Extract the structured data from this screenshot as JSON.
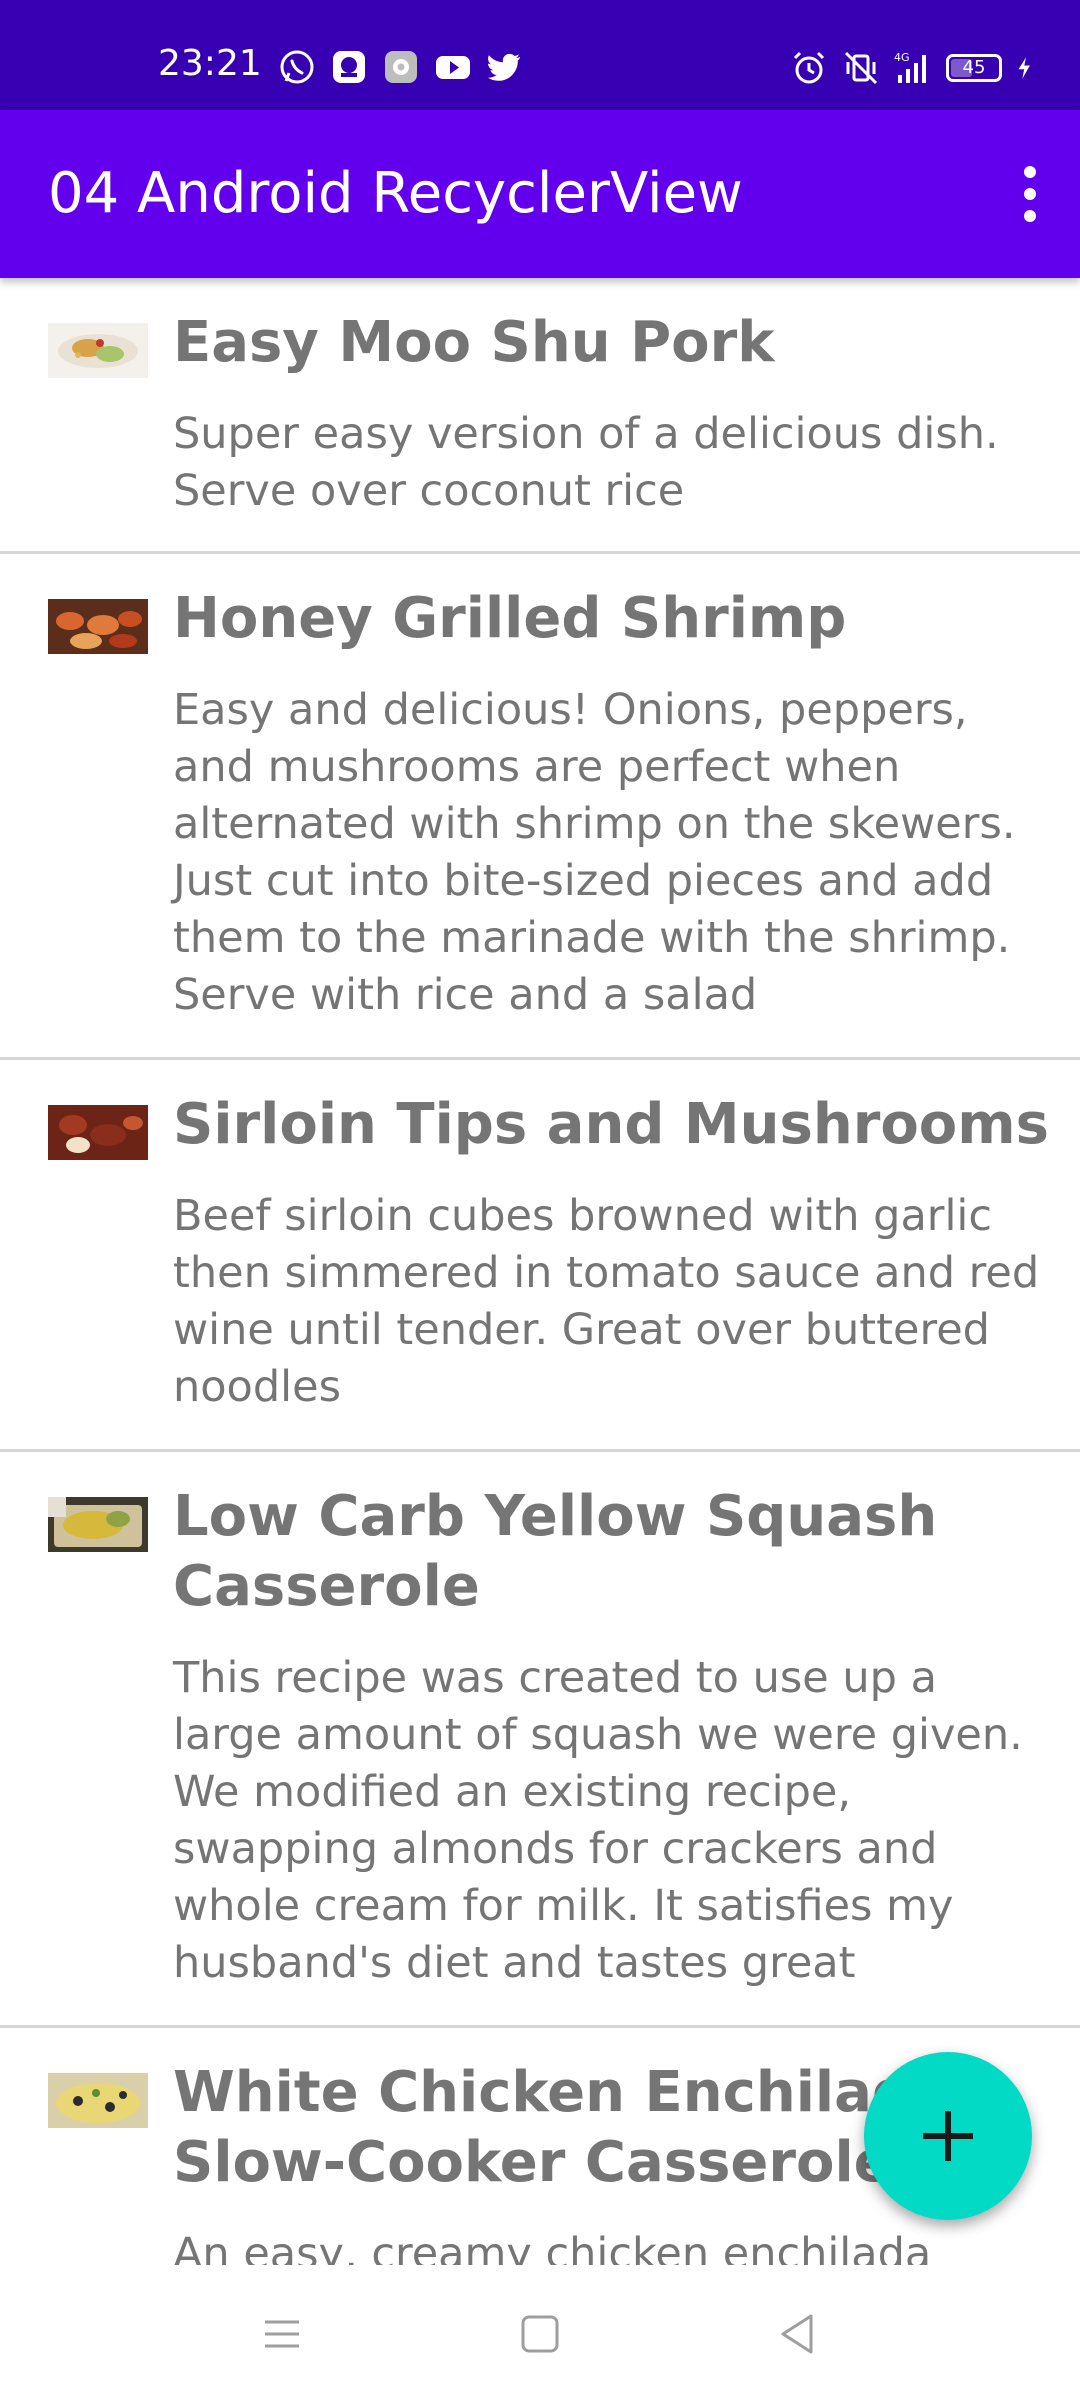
{
  "status_bar": {
    "time": "23:21",
    "battery": "45",
    "network": "4G",
    "app_icons": [
      "whatsapp-icon",
      "messenger-icon",
      "settings-app-icon",
      "youtube-icon",
      "twitter-icon"
    ],
    "right_icons": [
      "alarm-icon",
      "vibrate-icon",
      "signal-icon",
      "battery-icon",
      "charging-icon"
    ]
  },
  "app_bar": {
    "title": "04 Android RecyclerView",
    "menu_icon": "more-vert-icon",
    "color": "#6200ee",
    "status_color": "#3700b3"
  },
  "recipes": [
    {
      "title": "Easy Moo Shu Pork",
      "description": "Super easy version of a delicious dish. Serve over coconut rice",
      "thumbnail_icon": "moo-shu-pork-thumbnail"
    },
    {
      "title": "Honey Grilled Shrimp",
      "description": "Easy and delicious! Onions, peppers, and mushrooms are perfect when alternated with shrimp on the skewers. Just cut into bite-sized pieces and add them to the marinade with the shrimp. Serve with rice and a salad",
      "thumbnail_icon": "grilled-shrimp-thumbnail"
    },
    {
      "title": "Sirloin Tips and Mushrooms",
      "description": "Beef sirloin cubes browned with garlic then simmered in tomato sauce and red wine until tender. Great over buttered noodles",
      "thumbnail_icon": "sirloin-tips-thumbnail"
    },
    {
      "title": "Low Carb Yellow Squash Casserole",
      "description": "This recipe was created to use up a large amount of squash we were given. We modified an existing recipe, swapping almonds for crackers and whole cream for milk. It satisfies my husband's diet and tastes great",
      "thumbnail_icon": "squash-casserole-thumbnail"
    },
    {
      "title": "White Chicken Enchilada Slow-Cooker Casserole",
      "description": "An easy, creamy chicken enchilada",
      "thumbnail_icon": "chicken-enchilada-thumbnail"
    }
  ],
  "fab": {
    "icon": "add-icon",
    "color": "#03dac5"
  },
  "nav_bar": {
    "icons": [
      "menu-nav-icon",
      "home-nav-icon",
      "back-nav-icon"
    ]
  }
}
